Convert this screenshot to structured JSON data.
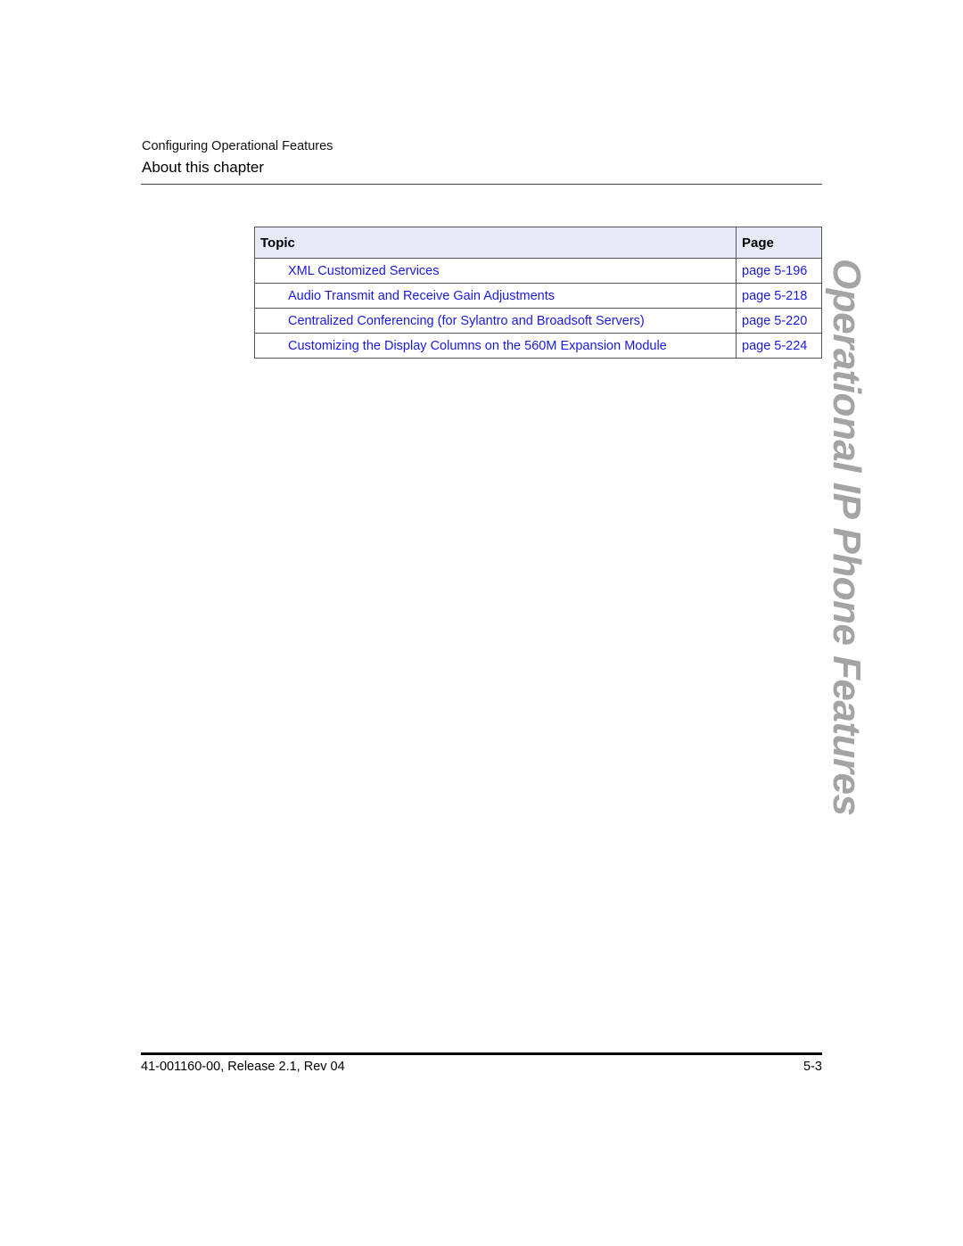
{
  "header": {
    "running_head": "Configuring Operational Features",
    "section_title": "About this chapter"
  },
  "table": {
    "columns": {
      "topic": "Topic",
      "page": "Page"
    },
    "rows": [
      {
        "topic": "XML Customized Services",
        "page": "page 5-196"
      },
      {
        "topic": "Audio Transmit and Receive Gain Adjustments",
        "page": "page 5-218"
      },
      {
        "topic": "Centralized Conferencing (for Sylantro and Broadsoft Servers)",
        "page": "page 5-220"
      },
      {
        "topic": "Customizing the Display Columns on the 560M Expansion Module",
        "page": "page 5-224"
      }
    ]
  },
  "side_title": "Operational IP Phone Features",
  "footer": {
    "document_id": "41-001160-00, Release 2.1, Rev 04",
    "page_number": "5-3"
  },
  "colors": {
    "link": "#1a1adf",
    "table_header_bg": "#e6ebf7",
    "side_title": "#a4a4a4"
  }
}
